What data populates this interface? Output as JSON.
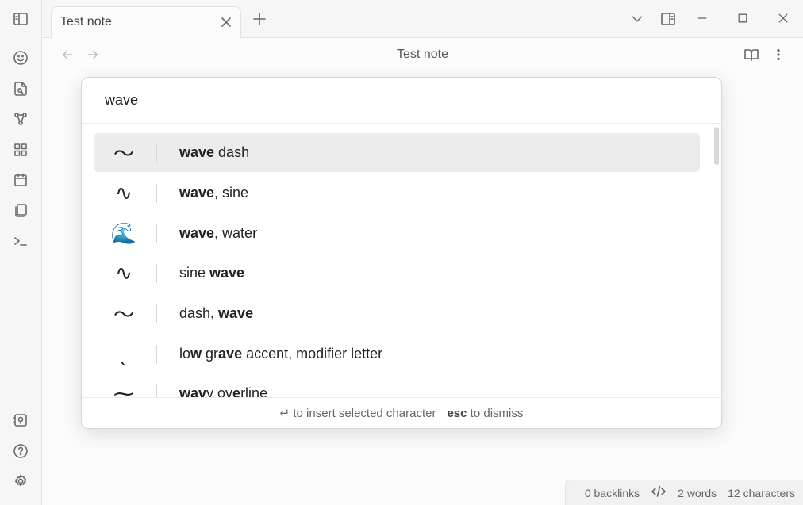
{
  "tab": {
    "title": "Test note"
  },
  "view": {
    "title": "Test note"
  },
  "prompt": {
    "query": "wave",
    "suggestions": [
      {
        "glyph": "〜",
        "parts": [
          {
            "t": "wave",
            "b": true
          },
          {
            "t": " dash",
            "b": false
          }
        ],
        "selected": true
      },
      {
        "glyph": "∿",
        "parts": [
          {
            "t": "wave",
            "b": true
          },
          {
            "t": ", sine",
            "b": false
          }
        ]
      },
      {
        "glyph": "🌊",
        "parts": [
          {
            "t": "wave",
            "b": true
          },
          {
            "t": ", water",
            "b": false
          }
        ]
      },
      {
        "glyph": "∿",
        "parts": [
          {
            "t": "sine ",
            "b": false
          },
          {
            "t": "wave",
            "b": true
          }
        ]
      },
      {
        "glyph": "〜",
        "parts": [
          {
            "t": "dash, ",
            "b": false
          },
          {
            "t": "wave",
            "b": true
          }
        ]
      },
      {
        "glyph": "ˎ",
        "parts": [
          {
            "t": "lo",
            "b": false
          },
          {
            "t": "w",
            "b": true
          },
          {
            "t": " gr",
            "b": false
          },
          {
            "t": "ave",
            "b": true
          },
          {
            "t": " accent, modifier letter",
            "b": false
          }
        ]
      },
      {
        "glyph": "⁓",
        "parts": [
          {
            "t": "wav",
            "b": true
          },
          {
            "t": "y ov",
            "b": false
          },
          {
            "t": "e",
            "b": true
          },
          {
            "t": "rline",
            "b": false
          }
        ]
      }
    ],
    "footer": {
      "insert_key": "↵",
      "insert_text": "to insert selected character",
      "dismiss_key": "esc",
      "dismiss_text": "to dismiss"
    }
  },
  "status": {
    "backlinks": "0 backlinks",
    "words": "2 words",
    "characters": "12 characters"
  },
  "ribbon_icons": [
    "sidebar-toggle-icon",
    "smiley-icon",
    "file-search-icon",
    "graph-icon",
    "dashboard-icon",
    "calendar-icon",
    "copy-icon",
    "terminal-icon",
    "vault-icon",
    "help-icon",
    "settings-icon"
  ]
}
